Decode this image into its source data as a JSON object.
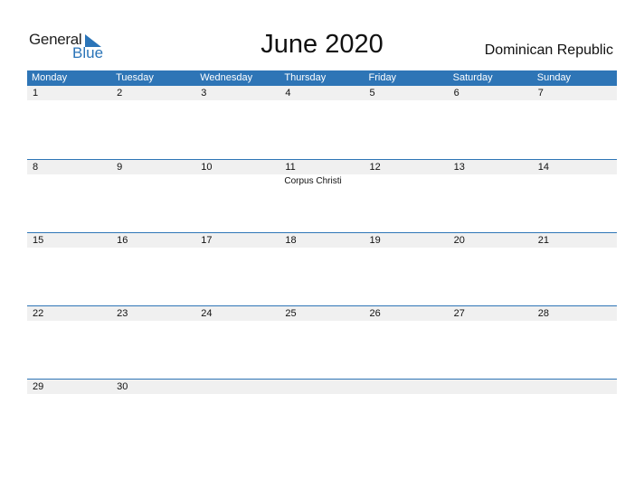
{
  "logo": {
    "word1": "General",
    "word2": "Blue"
  },
  "title": "June 2020",
  "country": "Dominican Republic",
  "colors": {
    "accent": "#2e75b6",
    "row_bg": "#f0f0f0"
  },
  "weekdays": [
    "Monday",
    "Tuesday",
    "Wednesday",
    "Thursday",
    "Friday",
    "Saturday",
    "Sunday"
  ],
  "weeks": [
    {
      "days": [
        "1",
        "2",
        "3",
        "4",
        "5",
        "6",
        "7"
      ],
      "events": [
        "",
        "",
        "",
        "",
        "",
        "",
        ""
      ]
    },
    {
      "days": [
        "8",
        "9",
        "10",
        "11",
        "12",
        "13",
        "14"
      ],
      "events": [
        "",
        "",
        "",
        "Corpus Christi",
        "",
        "",
        ""
      ]
    },
    {
      "days": [
        "15",
        "16",
        "17",
        "18",
        "19",
        "20",
        "21"
      ],
      "events": [
        "",
        "",
        "",
        "",
        "",
        "",
        ""
      ]
    },
    {
      "days": [
        "22",
        "23",
        "24",
        "25",
        "26",
        "27",
        "28"
      ],
      "events": [
        "",
        "",
        "",
        "",
        "",
        "",
        ""
      ]
    },
    {
      "days": [
        "29",
        "30",
        "",
        "",
        "",
        "",
        ""
      ],
      "events": [
        "",
        "",
        "",
        "",
        "",
        "",
        ""
      ]
    }
  ]
}
